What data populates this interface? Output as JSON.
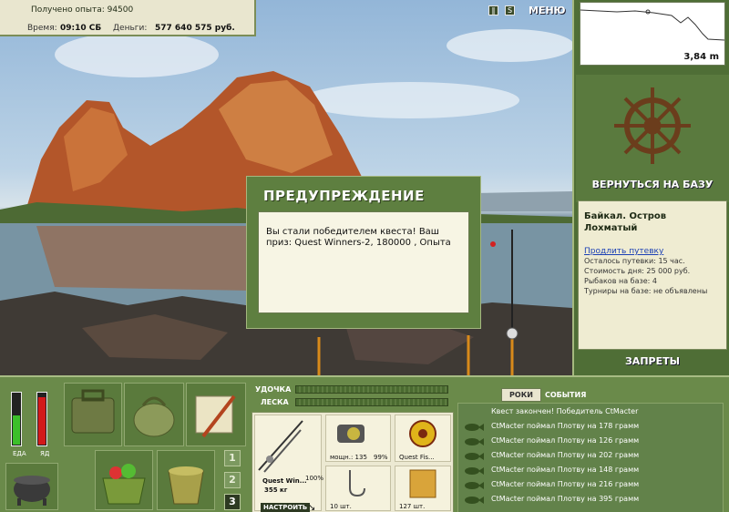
{
  "topbar": {
    "experience": "Получено опыта: 94500",
    "time_label": "Время:",
    "time_value": "09:10 СБ",
    "money_label": "Деньги:",
    "money_value": "577 640 575 руб."
  },
  "toolbar": {
    "pause_icon": "pause-icon",
    "sound_icon": "sound-icon",
    "menu_label": "МЕНЮ"
  },
  "depth": {
    "value": "3,84 m"
  },
  "right": {
    "return_base": "ВЕРНУТЬСЯ НА БАЗУ",
    "location_title": "Байкал. Остров Лохматый",
    "extend_link": "Продлить путевку",
    "remaining": "Осталось путевки: 15 час.",
    "day_cost": "Стоимость дня: 25 000 руб.",
    "fishers": "Рыбаков на базе: 4",
    "tournaments": "Турниры на базе: не объявлены",
    "bans": "ЗАПРЕТЫ"
  },
  "dialog": {
    "title": "ПРЕДУПРЕЖДЕНИЕ",
    "message": "Вы стали победителем квеста! Ваш приз: Quest Winners-2, 180000 , Опыта"
  },
  "meters": {
    "food_label": "ЕДА",
    "poison_label": "ЯД",
    "food_level": 0.55,
    "poison_level": 0.9,
    "food_color": "#3cbf2a",
    "poison_color": "#d21a1a"
  },
  "pages": [
    "1",
    "2",
    "3"
  ],
  "rodline": {
    "rod_label": "УДОЧКА",
    "line_label": "ЛЕСКА"
  },
  "gear": {
    "rod_name": "Quest Win...",
    "rod_weight": "355 кг",
    "rod_percent": "100%",
    "setup_label": "НАСТРОИТЬ",
    "reel_power": "мощн.: 135",
    "reel_percent": "99%",
    "line_name": "Quest Fis...",
    "hook_count": "10 шт.",
    "bait_count": "127 шт."
  },
  "events": {
    "tab_roki": "РОКИ",
    "tab_events": "СОБЫТИЯ",
    "items": [
      "Квест закончен! Победитель CtMacter",
      "CtMacter поймал Плотву на 178 грамм",
      "CtMacter поймал Плотву на 126 грамм",
      "CtMacter поймал Плотву на 202 грамм",
      "CtMacter поймал Плотву на 148 грамм",
      "CtMacter поймал Плотву на 216 грамм",
      "CtMacter поймал Плотву на 395 грамм"
    ]
  },
  "colors": {
    "panel_green": "#4f6e36",
    "panel_cream": "#efecd2",
    "link_blue": "#1a3fb5"
  }
}
